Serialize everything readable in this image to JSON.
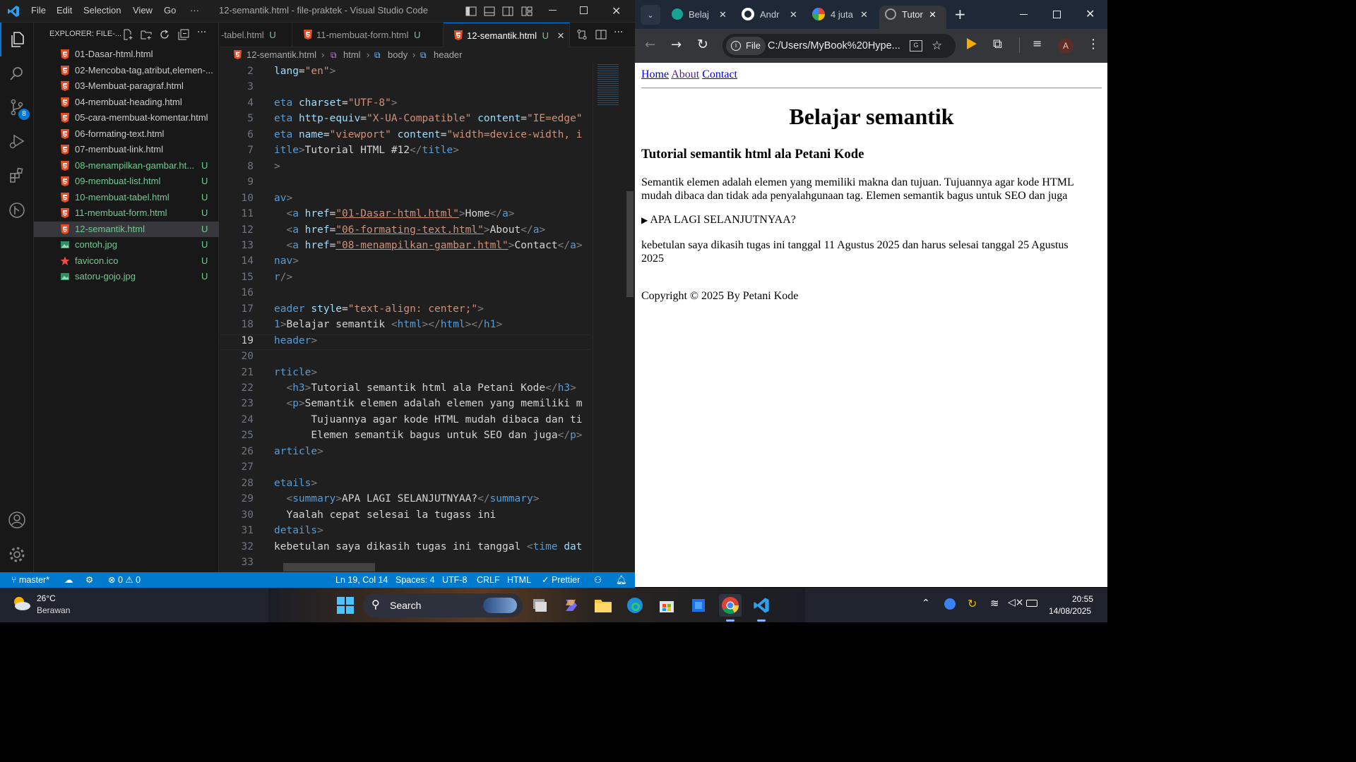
{
  "vscode": {
    "title": "12-semantik.html - file-praktek - Visual Studio Code",
    "menu": [
      "File",
      "Edit",
      "Selection",
      "View",
      "Go",
      "···"
    ],
    "explorer_title": "EXPLORER: FILE-...",
    "scm_badge": "8",
    "files": [
      {
        "name": "01-Dasar-html.html",
        "type": "html",
        "status": ""
      },
      {
        "name": "02-Mencoba-tag,atribut,elemen-...",
        "type": "html",
        "status": ""
      },
      {
        "name": "03-Membuat-paragraf.html",
        "type": "html",
        "status": ""
      },
      {
        "name": "04-membuat-heading.html",
        "type": "html",
        "status": ""
      },
      {
        "name": "05-cara-membuat-komentar.html",
        "type": "html",
        "status": ""
      },
      {
        "name": "06-formating-text.html",
        "type": "html",
        "status": ""
      },
      {
        "name": "07-membuat-link.html",
        "type": "html",
        "status": ""
      },
      {
        "name": "08-menampilkan-gambar.ht...",
        "type": "html",
        "status": "U"
      },
      {
        "name": "09-membuat-list.html",
        "type": "html",
        "status": "U"
      },
      {
        "name": "10-membuat-tabel.html",
        "type": "html",
        "status": "U"
      },
      {
        "name": "11-membuat-form.html",
        "type": "html",
        "status": "U"
      },
      {
        "name": "12-semantik.html",
        "type": "html",
        "status": "U",
        "selected": true
      },
      {
        "name": "contoh.jpg",
        "type": "image",
        "status": "U"
      },
      {
        "name": "favicon.ico",
        "type": "star",
        "status": "U"
      },
      {
        "name": "satoru-gojo.jpg",
        "type": "image",
        "status": "U"
      }
    ],
    "tabs": [
      {
        "label": "-tabel.html",
        "status": "U"
      },
      {
        "label": "11-membuat-form.html",
        "status": "U"
      },
      {
        "label": "12-semantik.html",
        "status": "U",
        "active": true
      }
    ],
    "breadcrumb": [
      "12-semantik.html",
      "html",
      "body",
      "header"
    ],
    "code_lines": [
      {
        "n": "2",
        "html": "<span class='tk-attr'>lang</span><span class='tk-txt'>=</span><span class='tk-str'>\"en\"</span><span class='tk-br'>&gt;</span>"
      },
      {
        "n": "3",
        "html": ""
      },
      {
        "n": "4",
        "html": "<span class='tk-tag'>eta</span> <span class='tk-attr'>charset</span><span class='tk-txt'>=</span><span class='tk-str'>\"UTF-8\"</span><span class='tk-br'>&gt;</span>"
      },
      {
        "n": "5",
        "html": "<span class='tk-tag'>eta</span> <span class='tk-attr'>http-equiv</span><span class='tk-txt'>=</span><span class='tk-str'>\"X-UA-Compatible\"</span> <span class='tk-attr'>content</span><span class='tk-txt'>=</span><span class='tk-str'>\"IE=edge\"</span>"
      },
      {
        "n": "6",
        "html": "<span class='tk-tag'>eta</span> <span class='tk-attr'>name</span><span class='tk-txt'>=</span><span class='tk-str'>\"viewport\"</span> <span class='tk-attr'>content</span><span class='tk-txt'>=</span><span class='tk-str'>\"width=device-width, i</span>"
      },
      {
        "n": "7",
        "html": "<span class='tk-tag'>itle</span><span class='tk-br'>&gt;</span><span class='tk-txt'>Tutorial HTML #12</span><span class='tk-br'>&lt;/</span><span class='tk-tag'>title</span><span class='tk-br'>&gt;</span>"
      },
      {
        "n": "8",
        "html": "<span class='tk-br'>&gt;</span>"
      },
      {
        "n": "9",
        "html": ""
      },
      {
        "n": "10",
        "html": "<span class='tk-tag'>av</span><span class='tk-br'>&gt;</span>"
      },
      {
        "n": "11",
        "html": "  <span class='tk-br'>&lt;</span><span class='tk-tag'>a</span> <span class='tk-attr'>href</span><span class='tk-txt'>=</span><span class='tk-str' style='text-decoration:underline'>\"01-Dasar-html.html\"</span><span class='tk-br'>&gt;</span><span class='tk-txt'>Home</span><span class='tk-br'>&lt;/</span><span class='tk-tag'>a</span><span class='tk-br'>&gt;</span>"
      },
      {
        "n": "12",
        "html": "  <span class='tk-br'>&lt;</span><span class='tk-tag'>a</span> <span class='tk-attr'>href</span><span class='tk-txt'>=</span><span class='tk-str' style='text-decoration:underline'>\"06-formating-text.html\"</span><span class='tk-br'>&gt;</span><span class='tk-txt'>About</span><span class='tk-br'>&lt;/</span><span class='tk-tag'>a</span><span class='tk-br'>&gt;</span>"
      },
      {
        "n": "13",
        "html": "  <span class='tk-br'>&lt;</span><span class='tk-tag'>a</span> <span class='tk-attr'>href</span><span class='tk-txt'>=</span><span class='tk-str' style='text-decoration:underline'>\"08-menampilkan-gambar.html\"</span><span class='tk-br'>&gt;</span><span class='tk-txt'>Contact</span><span class='tk-br'>&lt;/</span><span class='tk-tag'>a</span><span class='tk-br'>&gt;</span>"
      },
      {
        "n": "14",
        "html": "<span class='tk-tag'>nav</span><span class='tk-br'>&gt;</span>"
      },
      {
        "n": "15",
        "html": "<span class='tk-tag'>r</span><span class='tk-br'>/&gt;</span>"
      },
      {
        "n": "16",
        "html": ""
      },
      {
        "n": "17",
        "html": "<span class='tk-tag'>eader</span> <span class='tk-attr'>style</span><span class='tk-txt'>=</span><span class='tk-str'>\"text-align: center;\"</span><span class='tk-br'>&gt;</span>"
      },
      {
        "n": "18",
        "html": "<span class='tk-tag'>1</span><span class='tk-br'>&gt;</span><span class='tk-txt'>Belajar semantik </span><span class='tk-br'>&lt;</span><span class='tk-tag'>html</span><span class='tk-br'>&gt;&lt;/</span><span class='tk-tag'>html</span><span class='tk-br'>&gt;&lt;/</span><span class='tk-tag'>h1</span><span class='tk-br'>&gt;</span>"
      },
      {
        "n": "19",
        "html": "<span class='tk-tag'>header</span><span class='tk-br'>&gt;</span>"
      },
      {
        "n": "20",
        "html": ""
      },
      {
        "n": "21",
        "html": "<span class='tk-tag'>rticle</span><span class='tk-br'>&gt;</span>"
      },
      {
        "n": "22",
        "html": "  <span class='tk-br'>&lt;</span><span class='tk-tag'>h3</span><span class='tk-br'>&gt;</span><span class='tk-txt'>Tutorial semantik html ala Petani Kode</span><span class='tk-br'>&lt;/</span><span class='tk-tag'>h3</span><span class='tk-br'>&gt;</span>"
      },
      {
        "n": "23",
        "html": "  <span class='tk-br'>&lt;</span><span class='tk-tag'>p</span><span class='tk-br'>&gt;</span><span class='tk-txt'>Semantik elemen adalah elemen yang memiliki m</span>"
      },
      {
        "n": "24",
        "html": "      <span class='tk-txt'>Tujuannya agar kode HTML mudah dibaca dan ti</span>"
      },
      {
        "n": "25",
        "html": "      <span class='tk-txt'>Elemen semantik bagus untuk SEO dan juga</span><span class='tk-br'>&lt;/</span><span class='tk-tag'>p</span><span class='tk-br'>&gt;</span>"
      },
      {
        "n": "26",
        "html": "<span class='tk-tag'>article</span><span class='tk-br'>&gt;</span>"
      },
      {
        "n": "27",
        "html": ""
      },
      {
        "n": "28",
        "html": "<span class='tk-tag'>etails</span><span class='tk-br'>&gt;</span>"
      },
      {
        "n": "29",
        "html": "  <span class='tk-br'>&lt;</span><span class='tk-tag'>summary</span><span class='tk-br'>&gt;</span><span class='tk-txt'>APA LAGI SELANJUTNYAA?</span><span class='tk-br'>&lt;/</span><span class='tk-tag'>summary</span><span class='tk-br'>&gt;</span>"
      },
      {
        "n": "30",
        "html": "  <span class='tk-txt'>Yaalah cepat selesai la tugass ini</span>"
      },
      {
        "n": "31",
        "html": "<span class='tk-tag'>details</span><span class='tk-br'>&gt;</span>"
      },
      {
        "n": "32",
        "html": "<span class='tk-txt'>kebetulan saya dikasih tugas ini tanggal </span><span class='tk-br'>&lt;</span><span class='tk-tag'>time</span> <span class='tk-attr'>dat</span>"
      },
      {
        "n": "33",
        "html": ""
      }
    ],
    "status": {
      "branch": "master*",
      "problems_errors": "0",
      "problems_warnings": "0",
      "cursor": "Ln 19, Col 14",
      "spaces": "Spaces: 4",
      "encoding": "UTF-8",
      "eol": "CRLF",
      "language": "HTML",
      "formatter": "Prettier"
    }
  },
  "chrome": {
    "tabs": [
      {
        "label": "Belaj",
        "icon": "site-icon"
      },
      {
        "label": "Andr",
        "icon": "github-icon"
      },
      {
        "label": "4 juta",
        "icon": "google-icon"
      },
      {
        "label": "Tutor",
        "icon": "globe-icon",
        "active": true
      }
    ],
    "url_chip": "File",
    "url": "C:/Users/MyBook%20Hype...",
    "profile_initial": "A",
    "page": {
      "nav": [
        "Home",
        "About",
        "Contact"
      ],
      "h1": "Belajar semantik",
      "h3": "Tutorial semantik html ala Petani Kode",
      "p": "Semantik elemen adalah elemen yang memiliki makna dan tujuan. Tujuannya agar kode HTML mudah dibaca dan tidak ada penyalahgunaan tag. Elemen semantik bagus untuk SEO dan juga",
      "summary": "APA LAGI SELANJUTNYAA?",
      "dates_text": "kebetulan saya dikasih tugas ini tanggal 11 Agustus 2025 dan harus selesai tanggal 25 Agustus 2025",
      "footer": "Copyright © 2025 By Petani Kode"
    }
  },
  "taskbar": {
    "weather_temp": "26°C",
    "weather_desc": "Berawan",
    "search_label": "Search",
    "time": "20:55",
    "date": "14/08/2025"
  }
}
